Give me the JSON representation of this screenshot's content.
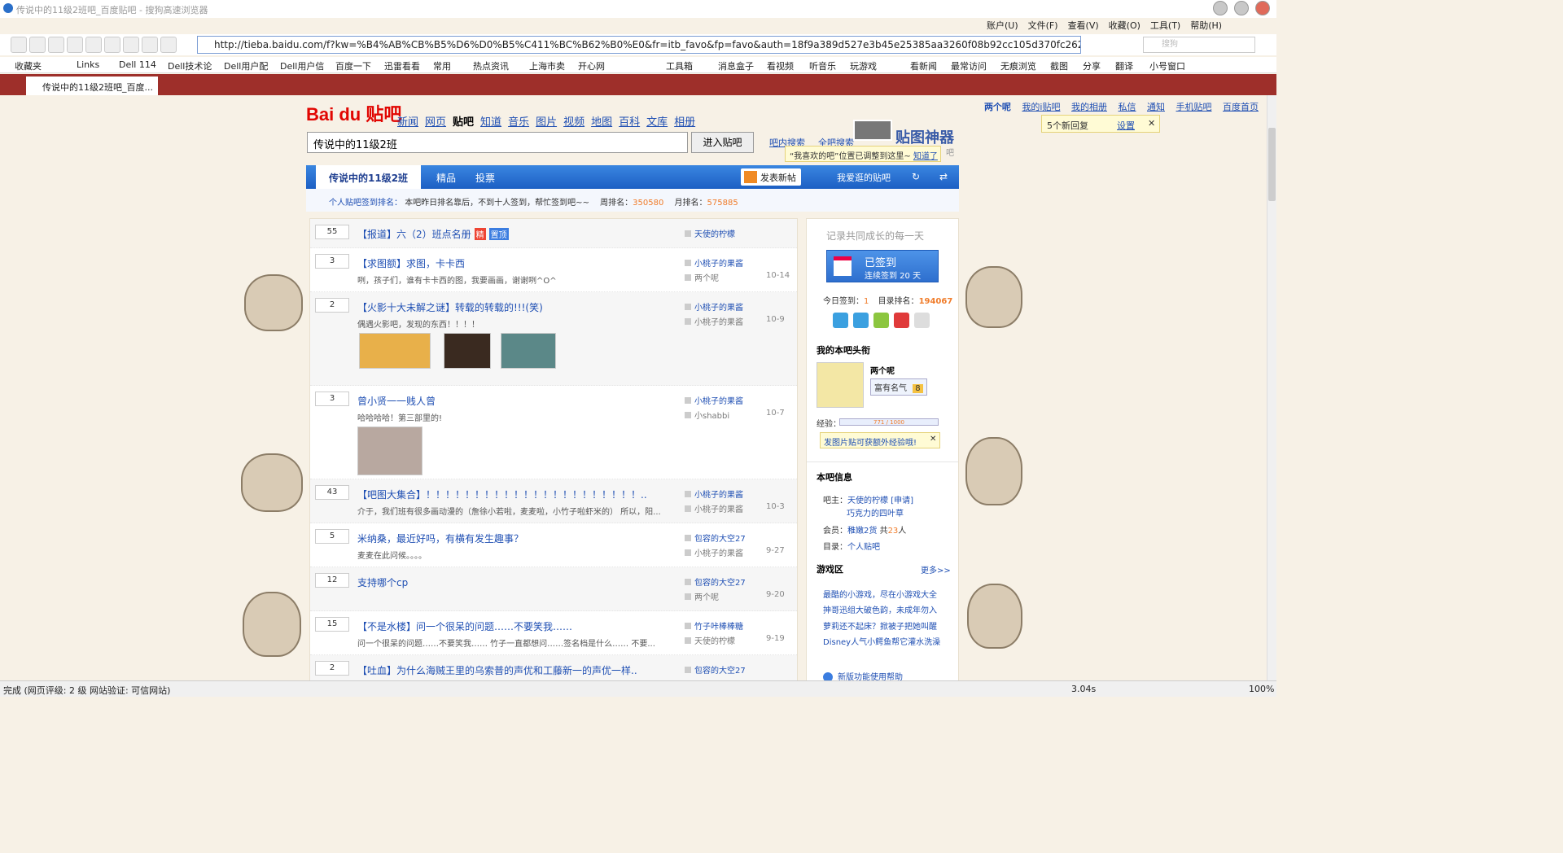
{
  "window": {
    "title": "传说中的11级2班吧_百度贴吧 - 搜狗高速浏览器"
  },
  "menu": [
    "账户(U)",
    "文件(F)",
    "查看(V)",
    "收藏(O)",
    "工具(T)",
    "帮助(H)"
  ],
  "address": "http://tieba.baidu.com/f?kw=%B4%AB%CB%B5%D6%D0%B5%C411%BC%B62%B0%E0&fr=itb_favo&fp=favo&auth=18f9a389d527e3b45e25385aa3260f08b92cc105d370fc262ed919bd749e3b1",
  "search_placeholder": "搜狗",
  "bookmarks": [
    "收藏夹",
    "Links",
    "Dell 114",
    "Dell技术论",
    "Dell用户配",
    "Dell用户信",
    "百度一下",
    "迅雷看看",
    "常用",
    "热点资讯",
    "上海市卖",
    "开心网",
    "工具箱",
    "消息盒子",
    "看视频",
    "听音乐",
    "玩游戏",
    "看新闻",
    "最常访问",
    "无痕浏览",
    "截图",
    "分享",
    "翻译",
    "小号窗口"
  ],
  "tab": {
    "label": "传说中的11级2班吧_百度..."
  },
  "toplinks": [
    "两个呢",
    "我的i贴吧",
    "我的相册",
    "私信",
    "通知",
    "手机贴吧",
    "百度首页"
  ],
  "newreply": {
    "text": "5个新回复",
    "action": "设置",
    "close": "✕"
  },
  "logo": "Bai du 贴吧",
  "nav": [
    "新闻",
    "网页",
    "贴吧",
    "知道",
    "音乐",
    "图片",
    "视频",
    "地图",
    "百科",
    "文库",
    "相册"
  ],
  "search": {
    "value": "传说中的11级2班",
    "button": "进入贴吧",
    "link1": "吧内搜索",
    "link2": "全吧搜索"
  },
  "tietu": "贴图神器",
  "favtip": {
    "text": "“我喜欢的吧”位置已调整到这里~",
    "link": "知道了"
  },
  "bar": {
    "name": "传说中的11级2班",
    "tabs": [
      "精品",
      "投票"
    ],
    "post": "发表新帖",
    "fav": "我爱逛的贴吧",
    "tail": "吧"
  },
  "signbar": {
    "label": "个人贴吧签到排名：",
    "text": "本吧昨日排名靠后，不到十人签到，帮忙签到吧~~",
    "week_label": "周排名：",
    "week": "350580",
    "month_label": "月排名：",
    "month": "575885"
  },
  "threads": [
    {
      "count": "55",
      "title": "【报道】六（2）班点名册",
      "tags": [
        "精",
        "置顶"
      ],
      "author": "天使的柠檬",
      "abstract": "",
      "reply": "",
      "date": ""
    },
    {
      "count": "3",
      "title": "【求图额】求图，卡卡西",
      "author": "小桃子的果酱",
      "abstract": "咧，孩子们，谁有卡卡西的图，我要画画，谢谢咧^O^",
      "reply": "两个呢",
      "date": "10-14"
    },
    {
      "count": "2",
      "title": "【火影十大未解之谜】转载的转载的!!!(笑)",
      "author": "小桃子的果酱",
      "abstract": "偶遇火影吧，发现的东西！！！！",
      "reply": "小桃子的果酱",
      "date": "10-9"
    },
    {
      "count": "3",
      "title": "曾小贤一一贱人曾",
      "author": "小桃子的果酱",
      "abstract": "哈哈哈哈！第三部里的!",
      "reply": "小shabbi",
      "date": "10-7"
    },
    {
      "count": "43",
      "title": "【吧图大集合】！！！！！！！！！！！！！！！！！！！！！！..",
      "author": "小桃子的果酱",
      "abstract": "介于，我们班有很多画动漫的（詹徐小若啦，麦麦啦，小竹子啦虾米的） 所以，阳...",
      "reply": "小桃子的果酱",
      "date": "10-3"
    },
    {
      "count": "5",
      "title": "米纳桑，最近好吗，有横有发生趣事？",
      "author": "包容的大空27",
      "abstract": "麦麦在此问候。。。。",
      "reply": "小桃子的果酱",
      "date": "9-27"
    },
    {
      "count": "12",
      "title": "支持哪个cp",
      "author": "包容的大空27",
      "abstract": "",
      "reply": "两个呢",
      "date": "9-20"
    },
    {
      "count": "15",
      "title": "【不是水楼】问一个很呆的问题……不要笑我……",
      "author": "竹子咔棒棒糖",
      "abstract": "问一个很呆的问题……不要笑我…… 竹子一直都想问……签名档是什么…… 不要...",
      "reply": "天使的柠檬",
      "date": "9-19"
    },
    {
      "count": "2",
      "title": "【吐血】为什么海贼王里的乌索普的声优和工藤新一的声优一样..",
      "author": "包容的大空27",
      "abstract": "",
      "reply": "",
      "date": ""
    }
  ],
  "side": {
    "motto": "记录共同成长的每一天",
    "signed": "已签到",
    "signed_days": "连续签到 20 天",
    "today_label": "今日签到：",
    "today": "1",
    "rank_label": "目录排名：",
    "rank": "194067",
    "my_title": "我的本吧头衔",
    "user": "两个呢",
    "badge": "富有名气",
    "badge_level": "8",
    "exp_label": "经验：",
    "exp": "771 / 1000",
    "tip": "发图片贴可获额外经验哦!",
    "info_title": "本吧信息",
    "owner_label": "吧主：",
    "owner1": "天使的柠檬",
    "apply": "[申请]",
    "owner2": "巧克力的四叶草",
    "member_label": "会员：",
    "member_name": "稚嫩2货",
    "member_count_pre": "共",
    "member_count": "23",
    "member_count_post": "人",
    "dir_label": "目录：",
    "dir": "个人贴吧",
    "game_title": "游戏区",
    "more": "更多>>",
    "games": [
      "最酷的小游戏，尽在小游戏大全",
      "抻哥迅组大破色韵，未成年勿入",
      "萝莉还不起床？掀被子把她叫醒",
      "Disney人气小鳄鱼帮它灌水洗澡"
    ],
    "help": "新版功能使用帮助"
  },
  "status": {
    "text": "完成 (网页评级: 2 级 网站验证: 可信网站)",
    "speed": "3.04s",
    "zoom": "100%"
  },
  "colors": {
    "tabbar": "#9e2f2a",
    "accent": "#1c5fc4",
    "link": "#1f4fb3",
    "orange": "#f07c2a"
  }
}
